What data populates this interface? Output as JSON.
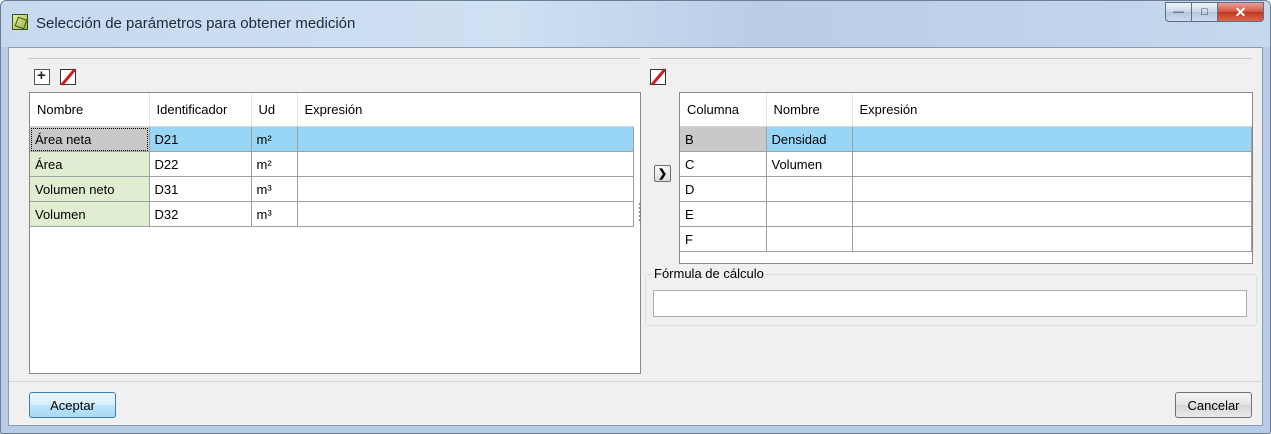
{
  "window": {
    "title": "Selección de parámetros para obtener medición"
  },
  "left_table": {
    "columns": [
      "Nombre",
      "Identificador",
      "Ud",
      "Expresión"
    ],
    "rows": [
      {
        "nombre": "Área neta",
        "id": "D21",
        "ud": "m²",
        "expr": ""
      },
      {
        "nombre": "Área",
        "id": "D22",
        "ud": "m²",
        "expr": ""
      },
      {
        "nombre": "Volumen neto",
        "id": "D31",
        "ud": "m³",
        "expr": ""
      },
      {
        "nombre": "Volumen",
        "id": "D32",
        "ud": "m³",
        "expr": ""
      }
    ]
  },
  "right_table": {
    "columns": [
      "Columna",
      "Nombre",
      "Expresión"
    ],
    "rows": [
      {
        "col": "B",
        "nombre": "Densidad",
        "expr": ""
      },
      {
        "col": "C",
        "nombre": "Volumen",
        "expr": ""
      },
      {
        "col": "D",
        "nombre": "",
        "expr": ""
      },
      {
        "col": "E",
        "nombre": "",
        "expr": ""
      },
      {
        "col": "F",
        "nombre": "",
        "expr": ""
      }
    ]
  },
  "formula": {
    "label": "Fórmula de cálculo",
    "value": ""
  },
  "buttons": {
    "accept": "Aceptar",
    "cancel": "Cancelar"
  },
  "icons": {
    "add": "add-row-icon",
    "erase": "eraser-icon",
    "transfer": "chevron-right-icon"
  },
  "colors": {
    "selection": "#99d6f6",
    "name_cell": "#dfeed0"
  }
}
